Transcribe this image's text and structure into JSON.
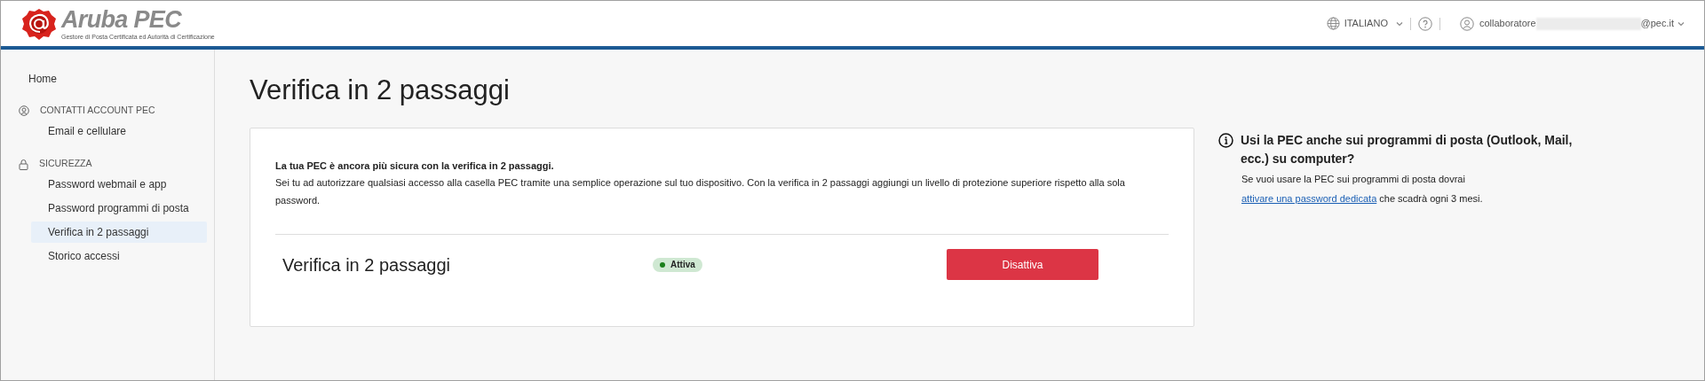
{
  "header": {
    "logo": {
      "name": "Aruba PEC",
      "tagline": "Gestore di Posta Certificata ed Autorità di Certificazione"
    },
    "language": "ITALIANO",
    "user": {
      "name_start": "collaboratore",
      "name_end": "@pec.it"
    }
  },
  "sidebar": {
    "home": "Home",
    "sections": [
      {
        "title": "CONTATTI ACCOUNT PEC",
        "kind": "account",
        "items": [
          {
            "label": "Email e cellulare",
            "selected": false
          }
        ]
      },
      {
        "title": "SICUREZZA",
        "kind": "security",
        "items": [
          {
            "label": "Password webmail e app",
            "selected": false
          },
          {
            "label": "Password programmi di posta",
            "selected": false
          },
          {
            "label": "Verifica in 2 passaggi",
            "selected": true
          },
          {
            "label": "Storico accessi",
            "selected": false
          }
        ]
      }
    ]
  },
  "main": {
    "title": "Verifica in 2 passaggi",
    "card": {
      "intro_bold": "La tua PEC è ancora più sicura con la verifica in 2 passaggi.",
      "intro": "Sei tu ad autorizzare qualsiasi accesso alla casella PEC tramite una semplice operazione sul tuo dispositivo. Con la verifica in 2 passaggi aggiungi un livello di protezione superiore rispetto alla sola password.",
      "row": {
        "label": "Verifica in 2 passaggi",
        "status": {
          "label": "Attiva",
          "active": true
        },
        "button": "Disattiva"
      }
    }
  },
  "info": {
    "title": "Usi la PEC anche sui programmi di posta (Outlook, Mail, ecc.) su computer?",
    "text": "Se vuoi usare la PEC sui programmi di posta dovrai",
    "link": "attivare una password dedicata",
    "text_after": "che scadrà ogni 3 mesi."
  }
}
